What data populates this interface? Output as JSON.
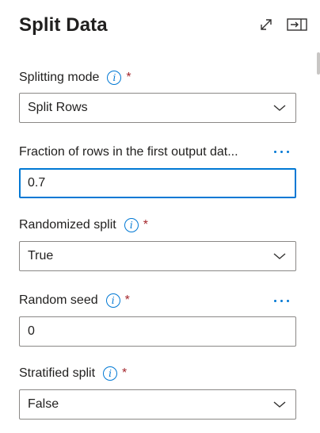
{
  "panel": {
    "title": "Split Data"
  },
  "fields": {
    "splitting_mode": {
      "label": "Splitting mode",
      "required_mark": "*",
      "value": "Split Rows"
    },
    "fraction": {
      "label": "Fraction of rows in the first output dat...",
      "value": "0.7"
    },
    "randomized": {
      "label": "Randomized split",
      "required_mark": "*",
      "value": "True"
    },
    "seed": {
      "label": "Random seed",
      "required_mark": "*",
      "value": "0"
    },
    "stratified": {
      "label": "Stratified split",
      "required_mark": "*",
      "value": "False"
    }
  },
  "icons": {
    "expand": "expand-icon",
    "dock": "dock-panel-icon",
    "info": "info-icon",
    "more": "more-options-icon",
    "chevron": "chevron-down-icon"
  },
  "colors": {
    "accent": "#0078d4",
    "required": "#a4262c",
    "border": "#8a8886"
  }
}
